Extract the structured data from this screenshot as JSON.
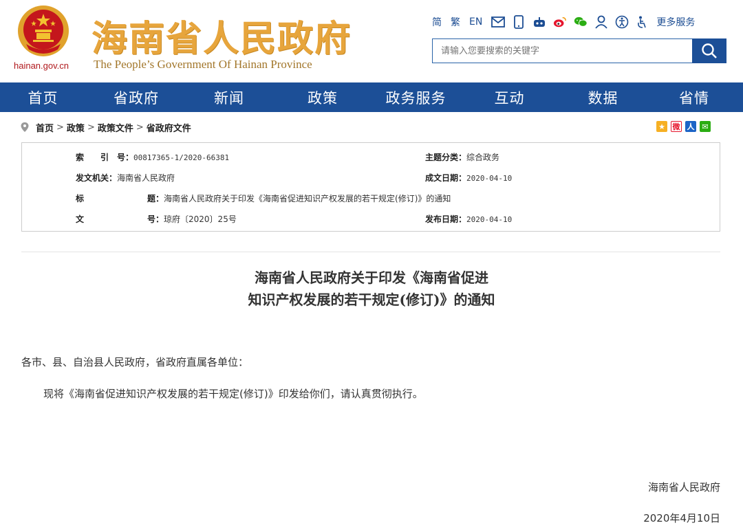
{
  "header": {
    "domain": "hainan.gov.cn",
    "title_cn": "海南省人民政府",
    "title_en": "The People’s Government Of Hainan Province"
  },
  "toolbar": {
    "simplified": "简",
    "traditional": "繁",
    "english": "EN",
    "icons": [
      "mail-icon",
      "mobile-icon",
      "robot-icon",
      "weibo-icon",
      "wechat-icon",
      "user-icon",
      "accessibility-icon",
      "elder-mode-icon"
    ],
    "more_services": "更多服务"
  },
  "search": {
    "placeholder": "请输入您要搜索的关键字"
  },
  "nav": {
    "items": [
      "首页",
      "省政府",
      "新闻",
      "政策",
      "政务服务",
      "互动",
      "数据",
      "省情"
    ]
  },
  "breadcrumb": {
    "items": [
      "首页",
      "政策",
      "政策文件",
      "省政府文件"
    ],
    "separator": ">"
  },
  "share": {
    "icons": [
      "qzone-icon",
      "weibo-share-icon",
      "renren-icon",
      "wechat-share-icon"
    ]
  },
  "meta": {
    "index_label": "索　　引　号：",
    "index_value": "00817365-1/2020-66381",
    "category_label": "主题分类：",
    "category_value": "综合政务",
    "issuer_label": "发文机关：",
    "issuer_value": "海南省人民政府",
    "written_label": "成文日期：",
    "written_value": "2020-04-10",
    "title_label_1": "标",
    "title_label_2": "题：",
    "title_value": "海南省人民政府关于印发《海南省促进知识产权发展的若干规定(修订)》的通知",
    "docno_label_1": "文",
    "docno_label_2": "号：",
    "docno_value": "琼府〔2020〕25号",
    "published_label": "发布日期：",
    "published_value": "2020-04-10"
  },
  "article": {
    "title_line1": "海南省人民政府关于印发《海南省促进",
    "title_line2": "知识产权发展的若干规定(修订)》的通知",
    "salutation": "各市、县、自治县人民政府，省政府直属各单位：",
    "body": "现将《海南省促进知识产权发展的若干规定(修订)》印发给你们，请认真贯彻执行。",
    "signer": "海南省人民政府",
    "date": "2020年4月10日"
  },
  "colors": {
    "brand_blue": "#1c4f97",
    "title_gold": "#e7a53c",
    "emblem_red": "#c4161c"
  }
}
